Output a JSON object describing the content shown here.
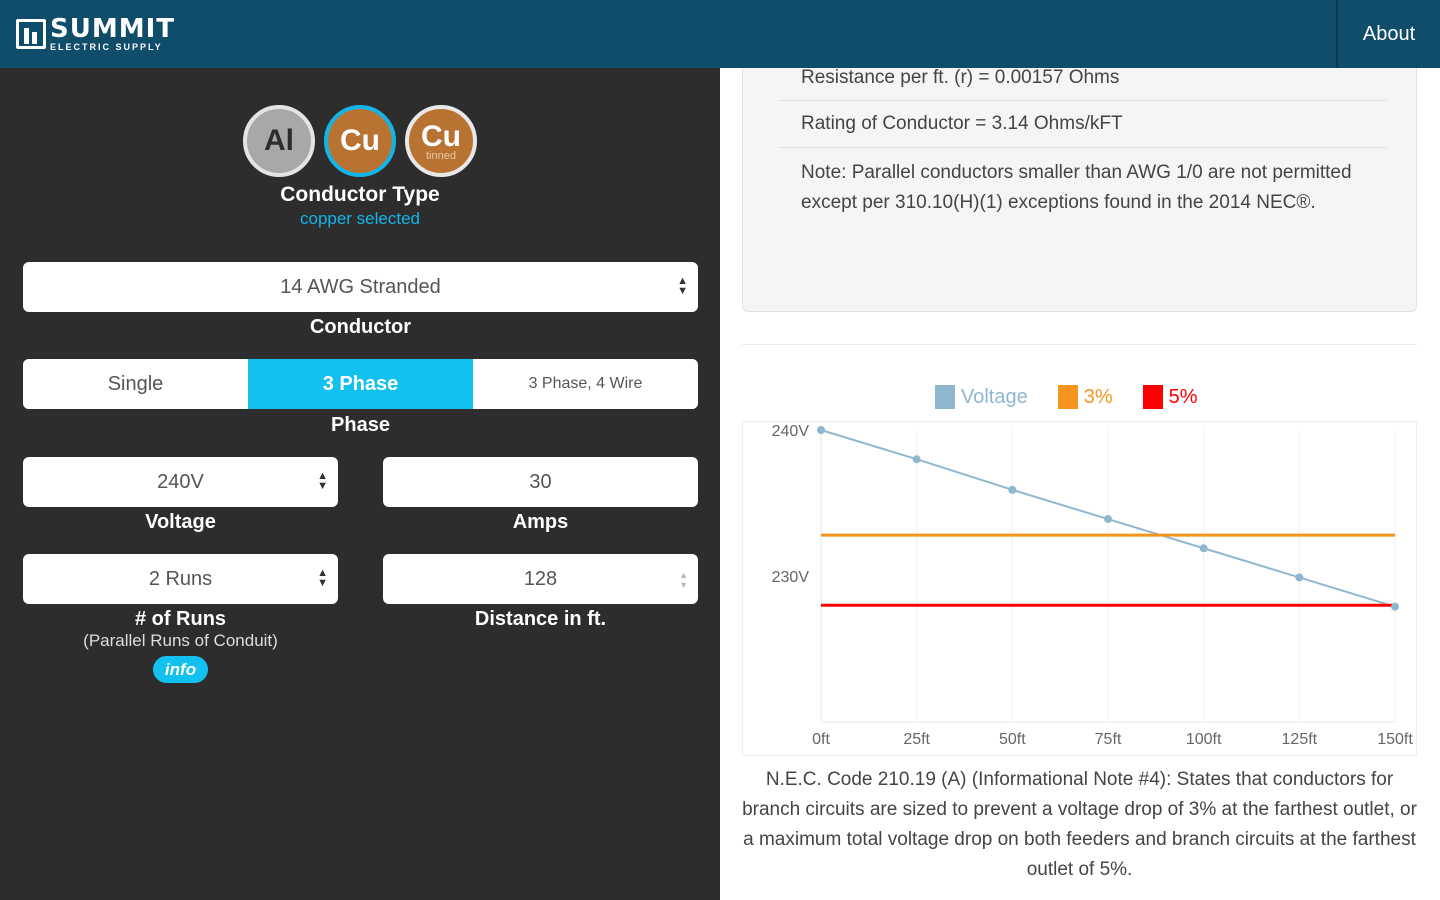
{
  "header": {
    "logo_name": "SUMMIT",
    "logo_sub": "ELECTRIC SUPPLY",
    "about_label": "About"
  },
  "conductor_type": {
    "options": [
      {
        "symbol": "Al",
        "sub": ""
      },
      {
        "symbol": "Cu",
        "sub": ""
      },
      {
        "symbol": "Cu",
        "sub": "tinned"
      }
    ],
    "label": "Conductor Type",
    "status": "copper selected"
  },
  "conductor": {
    "value": "14 AWG Stranded",
    "label": "Conductor"
  },
  "phase": {
    "options": [
      "Single",
      "3 Phase",
      "3 Phase, 4 Wire"
    ],
    "selected": "3 Phase",
    "label": "Phase"
  },
  "voltage": {
    "value": "240V",
    "label": "Voltage"
  },
  "amps": {
    "value": "30",
    "label": "Amps"
  },
  "runs": {
    "value": "2 Runs",
    "label": "# of Runs",
    "note": "(Parallel Runs of Conduit)",
    "info_label": "info"
  },
  "distance": {
    "value": "128",
    "label": "Distance in ft."
  },
  "results": {
    "resistance": "Resistance per ft. (r) = 0.00157 Ohms",
    "rating": "Rating of Conductor = 3.14 Ohms/kFT",
    "note": "Note: Parallel conductors smaller than AWG 1/0 are not permitted except per 310.10(H)(1) exceptions found in the 2014 NEC®."
  },
  "colors": {
    "header": "#0f4d6b",
    "accent": "#13c1f1",
    "voltage_series": "#8fb8d0",
    "three_pct": "#f7941d",
    "five_pct": "#ff0000"
  },
  "chart_data": {
    "type": "line",
    "x": [
      "0ft",
      "25ft",
      "50ft",
      "75ft",
      "100ft",
      "125ft",
      "150ft"
    ],
    "x_values": [
      0,
      25,
      50,
      75,
      100,
      125,
      150
    ],
    "y_tick_labels": [
      "240V",
      "230V"
    ],
    "y_ticks": [
      240,
      230
    ],
    "ylim": [
      220,
      240
    ],
    "series": [
      {
        "name": "Voltage",
        "color": "#8fb8d0",
        "values": [
          240,
          238,
          235.9,
          233.9,
          231.9,
          229.9,
          227.9
        ]
      },
      {
        "name": "3%",
        "color": "#f7941d",
        "values": [
          232.8,
          232.8,
          232.8,
          232.8,
          232.8,
          232.8,
          232.8
        ]
      },
      {
        "name": "5%",
        "color": "#ff0000",
        "values": [
          228,
          228,
          228,
          228,
          228,
          228,
          228
        ]
      }
    ],
    "grid": true,
    "legend": "top-center"
  },
  "nec_note": "N.E.C. Code 210.19 (A) (Informational Note #4): States that conductors for branch circuits are sized to prevent a voltage drop of 3% at the farthest outlet, or a maximum total voltage drop on both feeders and branch circuits at the farthest outlet of 5%."
}
